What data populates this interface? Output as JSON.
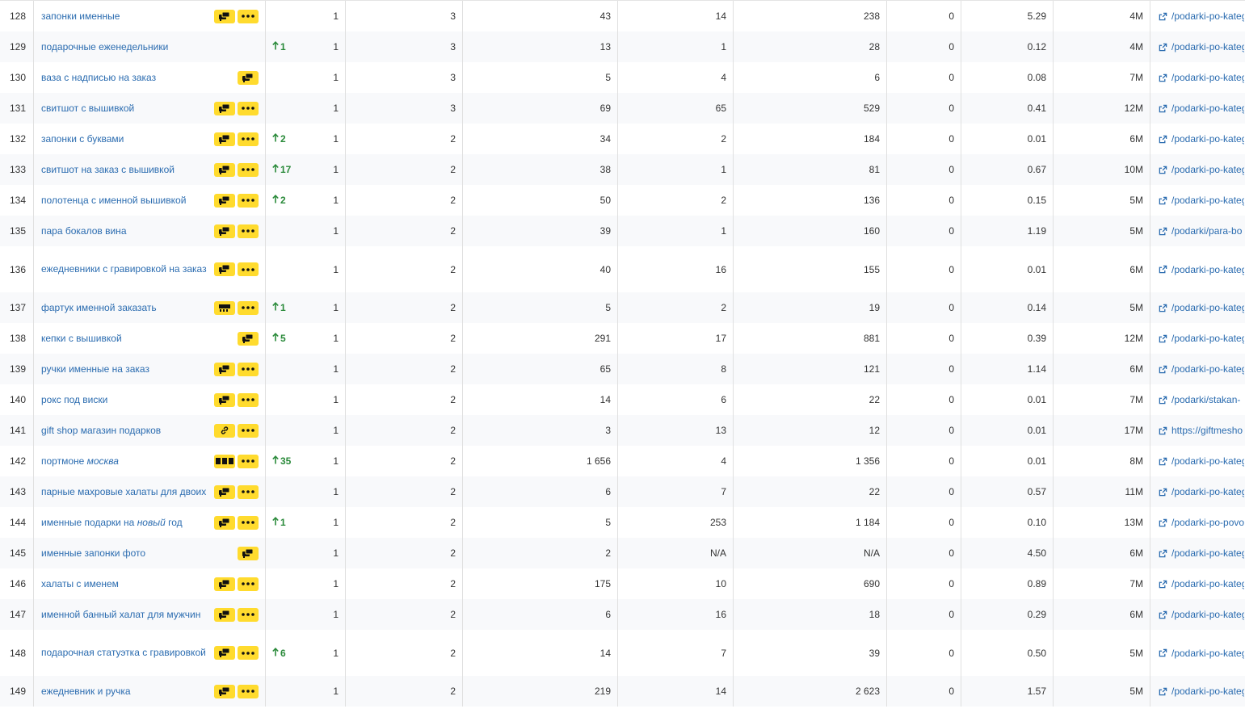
{
  "colors": {
    "accent_link": "#2b6cb0",
    "badge_yellow": "#ffdb2e",
    "positive_green": "#2a8a3a"
  },
  "rows": [
    {
      "num": "128",
      "kw": [
        {
          "t": "запонки именные",
          "i": false
        }
      ],
      "badges": [
        "serp-features-icon",
        "more-icon"
      ],
      "diff": "",
      "pos": "1",
      "v3": "3",
      "v4": "43",
      "v5": "14",
      "v6": "238",
      "v7": "0",
      "v8": "5.29",
      "v9": "4M",
      "url": "/podarki-po-kateg",
      "tall": false
    },
    {
      "num": "129",
      "kw": [
        {
          "t": "подарочные еженедельники",
          "i": false
        }
      ],
      "badges": [],
      "diff": "1",
      "pos": "1",
      "v3": "3",
      "v4": "13",
      "v5": "1",
      "v6": "28",
      "v7": "0",
      "v8": "0.12",
      "v9": "4M",
      "url": "/podarki-po-kateg",
      "tall": false
    },
    {
      "num": "130",
      "kw": [
        {
          "t": "ваза с надписью на заказ",
          "i": false
        }
      ],
      "badges": [
        "serp-features-icon"
      ],
      "diff": "",
      "pos": "1",
      "v3": "3",
      "v4": "5",
      "v5": "4",
      "v6": "6",
      "v7": "0",
      "v8": "0.08",
      "v9": "7M",
      "url": "/podarki-po-kateg",
      "tall": false
    },
    {
      "num": "131",
      "kw": [
        {
          "t": "свитшот с вышивкой",
          "i": false
        }
      ],
      "badges": [
        "serp-features-icon",
        "more-icon"
      ],
      "diff": "",
      "pos": "1",
      "v3": "3",
      "v4": "69",
      "v5": "65",
      "v6": "529",
      "v7": "0",
      "v8": "0.41",
      "v9": "12M",
      "url": "/podarki-po-kateg",
      "tall": false
    },
    {
      "num": "132",
      "kw": [
        {
          "t": "запонки с буквами",
          "i": false
        }
      ],
      "badges": [
        "serp-features-icon",
        "more-icon"
      ],
      "diff": "2",
      "pos": "1",
      "v3": "2",
      "v4": "34",
      "v5": "2",
      "v6": "184",
      "v7": "0",
      "v8": "0.01",
      "v9": "6M",
      "url": "/podarki-po-kateg",
      "tall": false
    },
    {
      "num": "133",
      "kw": [
        {
          "t": "свитшот на заказ с вышивкой",
          "i": false
        }
      ],
      "badges": [
        "serp-features-icon",
        "more-icon"
      ],
      "diff": "17",
      "pos": "1",
      "v3": "2",
      "v4": "38",
      "v5": "1",
      "v6": "81",
      "v7": "0",
      "v8": "0.67",
      "v9": "10M",
      "url": "/podarki-po-kateg",
      "tall": false
    },
    {
      "num": "134",
      "kw": [
        {
          "t": "полотенца с именной вышивкой",
          "i": false
        }
      ],
      "badges": [
        "serp-features-icon",
        "more-icon"
      ],
      "diff": "2",
      "pos": "1",
      "v3": "2",
      "v4": "50",
      "v5": "2",
      "v6": "136",
      "v7": "0",
      "v8": "0.15",
      "v9": "5M",
      "url": "/podarki-po-kateg",
      "tall": false
    },
    {
      "num": "135",
      "kw": [
        {
          "t": "пара бокалов вина",
          "i": false
        }
      ],
      "badges": [
        "serp-features-icon",
        "more-icon"
      ],
      "diff": "",
      "pos": "1",
      "v3": "2",
      "v4": "39",
      "v5": "1",
      "v6": "160",
      "v7": "0",
      "v8": "1.19",
      "v9": "5M",
      "url": "/podarki/para-bo",
      "tall": false
    },
    {
      "num": "136",
      "kw": [
        {
          "t": "ежедневники с гравировкой на заказ",
          "i": false
        }
      ],
      "badges": [
        "serp-features-icon",
        "more-icon"
      ],
      "diff": "",
      "pos": "1",
      "v3": "2",
      "v4": "40",
      "v5": "16",
      "v6": "155",
      "v7": "0",
      "v8": "0.01",
      "v9": "6M",
      "url": "/podarki-po-kateg",
      "tall": true
    },
    {
      "num": "137",
      "kw": [
        {
          "t": "фартук именной заказать",
          "i": false
        }
      ],
      "badges": [
        "shopping-icon",
        "more-icon"
      ],
      "diff": "1",
      "pos": "1",
      "v3": "2",
      "v4": "5",
      "v5": "2",
      "v6": "19",
      "v7": "0",
      "v8": "0.14",
      "v9": "5M",
      "url": "/podarki-po-kateg",
      "tall": false
    },
    {
      "num": "138",
      "kw": [
        {
          "t": "кепки с вышивкой",
          "i": false
        }
      ],
      "badges": [
        "serp-features-icon"
      ],
      "diff": "5",
      "pos": "1",
      "v3": "2",
      "v4": "291",
      "v5": "17",
      "v6": "881",
      "v7": "0",
      "v8": "0.39",
      "v9": "12M",
      "url": "/podarki-po-kateg",
      "tall": false
    },
    {
      "num": "139",
      "kw": [
        {
          "t": "ручки именные на заказ",
          "i": false
        }
      ],
      "badges": [
        "serp-features-icon",
        "more-icon"
      ],
      "diff": "",
      "pos": "1",
      "v3": "2",
      "v4": "65",
      "v5": "8",
      "v6": "121",
      "v7": "0",
      "v8": "1.14",
      "v9": "6M",
      "url": "/podarki-po-kateg",
      "tall": false
    },
    {
      "num": "140",
      "kw": [
        {
          "t": "рокс под виски",
          "i": false
        }
      ],
      "badges": [
        "serp-features-icon",
        "more-icon"
      ],
      "diff": "",
      "pos": "1",
      "v3": "2",
      "v4": "14",
      "v5": "6",
      "v6": "22",
      "v7": "0",
      "v8": "0.01",
      "v9": "7M",
      "url": "/podarki/stakan-",
      "tall": false
    },
    {
      "num": "141",
      "kw": [
        {
          "t": "gift shop магазин подарков",
          "i": false
        }
      ],
      "badges": [
        "link-icon",
        "more-icon"
      ],
      "diff": "",
      "pos": "1",
      "v3": "2",
      "v4": "3",
      "v5": "13",
      "v6": "12",
      "v7": "0",
      "v8": "0.01",
      "v9": "17M",
      "url": "https://giftmesho",
      "tall": false
    },
    {
      "num": "142",
      "kw": [
        {
          "t": "портмоне ",
          "i": false
        },
        {
          "t": "москва",
          "i": true
        }
      ],
      "badges": [
        "ads-icon",
        "more-icon"
      ],
      "diff": "35",
      "pos": "1",
      "v3": "2",
      "v4": "1 656",
      "v5": "4",
      "v6": "1 356",
      "v7": "0",
      "v8": "0.01",
      "v9": "8M",
      "url": "/podarki-po-kateg",
      "tall": false
    },
    {
      "num": "143",
      "kw": [
        {
          "t": "парные махровые халаты для двоих",
          "i": false
        }
      ],
      "badges": [
        "serp-features-icon",
        "more-icon"
      ],
      "diff": "",
      "pos": "1",
      "v3": "2",
      "v4": "6",
      "v5": "7",
      "v6": "22",
      "v7": "0",
      "v8": "0.57",
      "v9": "11M",
      "url": "/podarki-po-kateg",
      "tall": false
    },
    {
      "num": "144",
      "kw": [
        {
          "t": "именные подарки на ",
          "i": false
        },
        {
          "t": "новый",
          "i": true
        },
        {
          "t": " год",
          "i": false
        }
      ],
      "badges": [
        "serp-features-icon",
        "more-icon"
      ],
      "diff": "1",
      "pos": "1",
      "v3": "2",
      "v4": "5",
      "v5": "253",
      "v6": "1 184",
      "v7": "0",
      "v8": "0.10",
      "v9": "13M",
      "url": "/podarki-po-povo",
      "tall": false
    },
    {
      "num": "145",
      "kw": [
        {
          "t": "именные запонки фото",
          "i": false
        }
      ],
      "badges": [
        "serp-features-icon"
      ],
      "diff": "",
      "pos": "1",
      "v3": "2",
      "v4": "2",
      "v5": "N/A",
      "v6": "N/A",
      "v7": "0",
      "v8": "4.50",
      "v9": "6M",
      "url": "/podarki-po-kateg",
      "tall": false
    },
    {
      "num": "146",
      "kw": [
        {
          "t": "халаты с именем",
          "i": false
        }
      ],
      "badges": [
        "serp-features-icon",
        "more-icon"
      ],
      "diff": "",
      "pos": "1",
      "v3": "2",
      "v4": "175",
      "v5": "10",
      "v6": "690",
      "v7": "0",
      "v8": "0.89",
      "v9": "7M",
      "url": "/podarki-po-kateg",
      "tall": false
    },
    {
      "num": "147",
      "kw": [
        {
          "t": "именной банный халат для мужчин",
          "i": false
        }
      ],
      "badges": [
        "serp-features-icon",
        "more-icon"
      ],
      "diff": "",
      "pos": "1",
      "v3": "2",
      "v4": "6",
      "v5": "16",
      "v6": "18",
      "v7": "0",
      "v8": "0.29",
      "v9": "6M",
      "url": "/podarki-po-kateg",
      "tall": false
    },
    {
      "num": "148",
      "kw": [
        {
          "t": "подарочная статуэтка с гравировкой",
          "i": false
        }
      ],
      "badges": [
        "serp-features-icon",
        "more-icon"
      ],
      "diff": "6",
      "pos": "1",
      "v3": "2",
      "v4": "14",
      "v5": "7",
      "v6": "39",
      "v7": "0",
      "v8": "0.50",
      "v9": "5M",
      "url": "/podarki-po-kateg",
      "tall": true
    },
    {
      "num": "149",
      "kw": [
        {
          "t": "ежедневник и ручка",
          "i": false
        }
      ],
      "badges": [
        "serp-features-icon",
        "more-icon"
      ],
      "diff": "",
      "pos": "1",
      "v3": "2",
      "v4": "219",
      "v5": "14",
      "v6": "2 623",
      "v7": "0",
      "v8": "1.57",
      "v9": "5M",
      "url": "/podarki-po-kateg",
      "tall": false
    }
  ]
}
